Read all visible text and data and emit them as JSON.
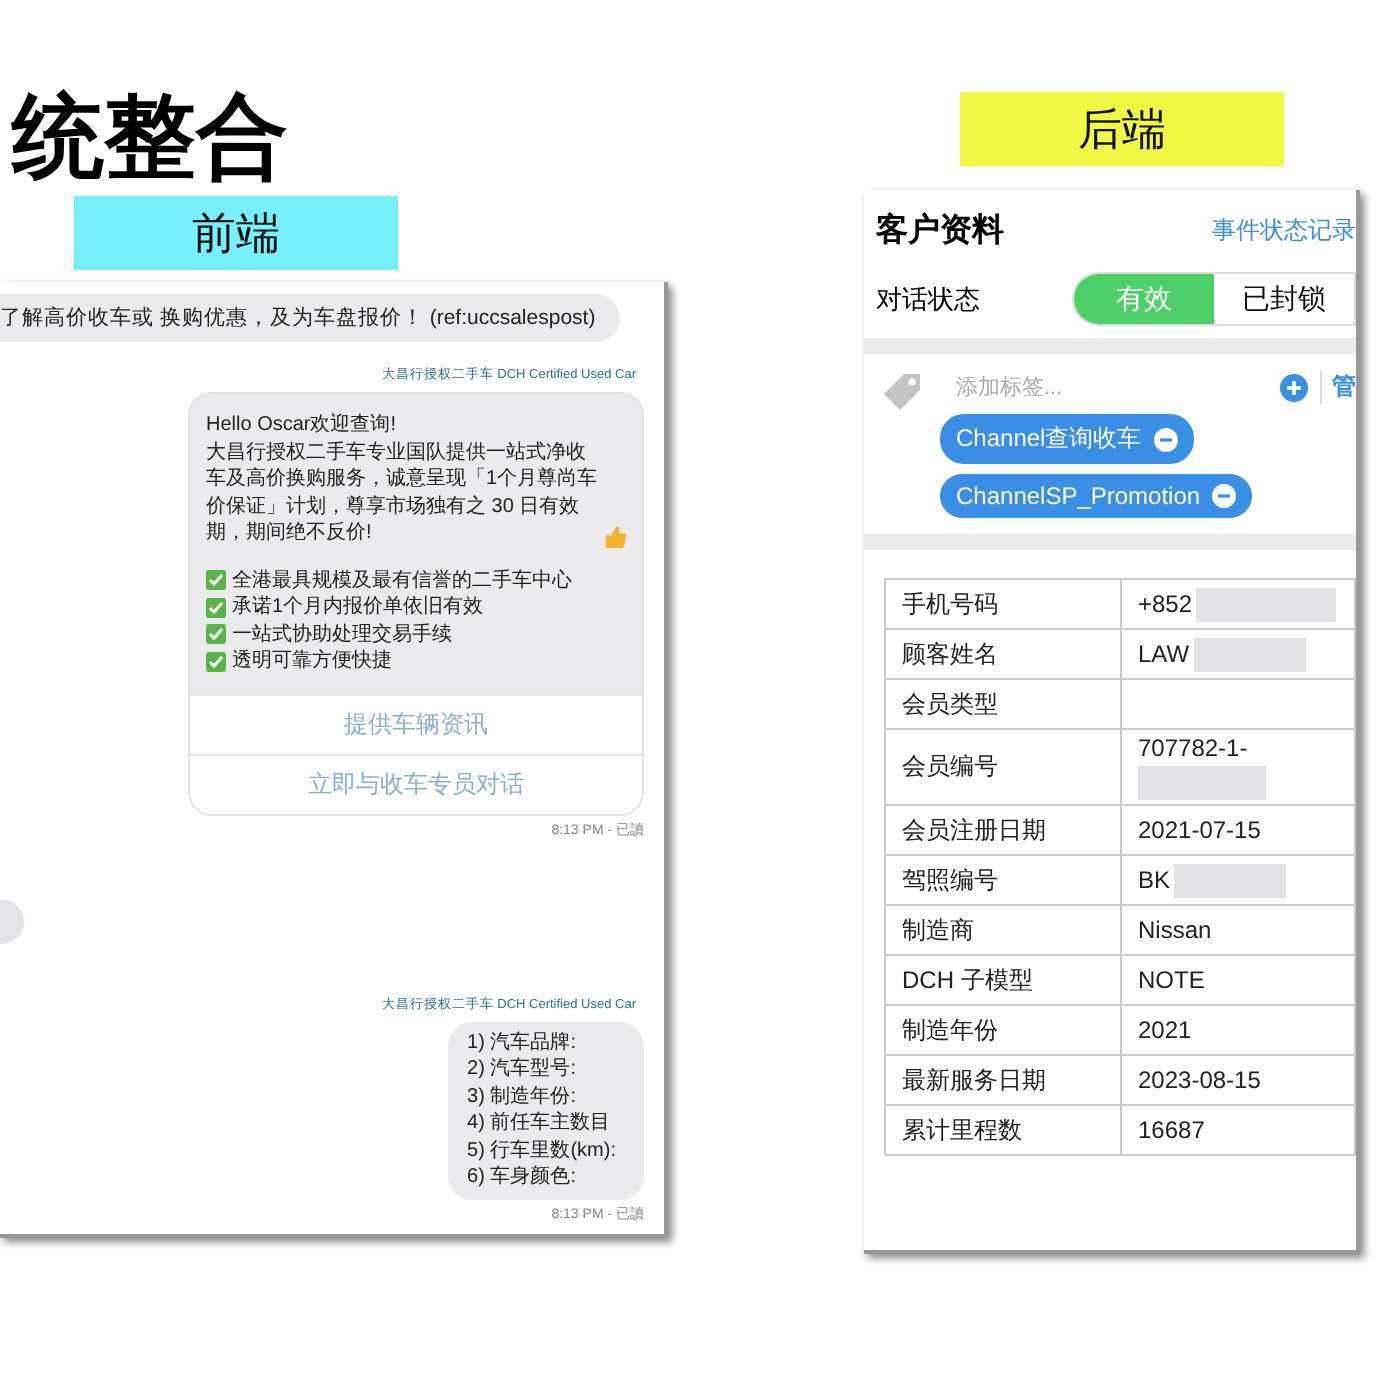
{
  "title": "统整合",
  "frontend": {
    "label": "前端",
    "chat": {
      "incoming_top": "了解高价收车或 换购优惠，及为车盘报价！ (ref:uccsalespost)",
      "messages": [
        {
          "kind": "card",
          "sender": "大昌行授权二手车 DCH Certified Used Car",
          "greeting": "Hello Oscar欢迎查询!",
          "paragraph": "大昌行授权二手车专业国队提供一站式净收车及高价换购服务，诚意呈现「1个月尊尚车价保证」计划，尊享市场独有之 30 日有效期，期间绝不反价!",
          "checks": [
            "全港最具规模及最有信誉的二手车中心",
            "承诺1个月内报价单依旧有效",
            "一站式协助处理交易手续",
            "透明可靠方便快捷"
          ],
          "buttons": [
            "提供车辆资讯",
            "立即与收车专员对话"
          ],
          "time": "8:13 PM - 已讀"
        },
        {
          "kind": "incoming_stub"
        },
        {
          "kind": "list",
          "sender": "大昌行授权二手车 DCH Certified Used Car",
          "lines": [
            "1) 汽车品牌:",
            "2) 汽车型号:",
            "3) 制造年份:",
            "4) 前任车主数目",
            "5) 行车里数(km):",
            "6) 车身颜色:"
          ],
          "time": "8:13 PM - 已讀"
        }
      ]
    }
  },
  "backend": {
    "label": "后端",
    "header": {
      "title": "客户资料",
      "link": "事件状态记录"
    },
    "status": {
      "label": "对话状态",
      "options": [
        {
          "label": "有效",
          "selected": true
        },
        {
          "label": "已封锁",
          "selected": false
        }
      ]
    },
    "tags": {
      "placeholder": "添加标签...",
      "manage": "管",
      "chips": [
        "Channel查询收车",
        "ChannelSP_Promotion"
      ]
    },
    "table": {
      "rows": [
        {
          "label": "手机号码",
          "value": "+852",
          "redacted": true
        },
        {
          "label": "顾客姓名",
          "value": "LAW",
          "redacted": true
        },
        {
          "label": "会员类型",
          "value": "",
          "redacted": false
        },
        {
          "label": "会员编号",
          "value": "707782-1-",
          "redacted": true
        },
        {
          "label": "会员注册日期",
          "value": "2021-07-15",
          "redacted": false
        },
        {
          "label": "驾照编号",
          "value": "BK",
          "redacted": true
        },
        {
          "label": "制造商",
          "value": "Nissan",
          "redacted": false
        },
        {
          "label": "DCH 子模型",
          "value": "NOTE",
          "redacted": false
        },
        {
          "label": "制造年份",
          "value": "2021",
          "redacted": false
        },
        {
          "label": "最新服务日期",
          "value": "2023-08-15",
          "redacted": false
        },
        {
          "label": "累计里程数",
          "value": "16687",
          "redacted": false
        }
      ]
    }
  }
}
